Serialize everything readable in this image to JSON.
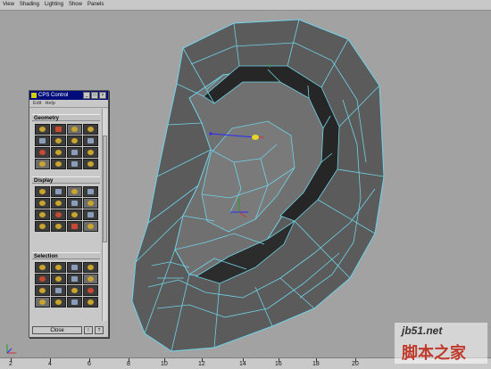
{
  "menubar": {
    "items": [
      "View",
      "Shading",
      "Lighting",
      "Show",
      "Panels"
    ]
  },
  "viewport": {
    "camera": "persp"
  },
  "panel": {
    "title": "CPS Control",
    "menu": [
      "Edit",
      "Help"
    ],
    "sections": [
      "Geometry",
      "Display",
      "Selection"
    ],
    "close_label": "Close"
  },
  "timeline": {
    "ticks": [
      "2",
      "4",
      "6",
      "8",
      "10",
      "12",
      "14",
      "16",
      "18",
      "20"
    ]
  },
  "watermark": {
    "top": "jb51.net",
    "bottom": "脚本之家"
  },
  "colors": {
    "wire": "#6fd3e8",
    "mesh": "#5c5c5c",
    "viewport_bg": "#a2a2a2",
    "panel_title": "#000c7a"
  }
}
